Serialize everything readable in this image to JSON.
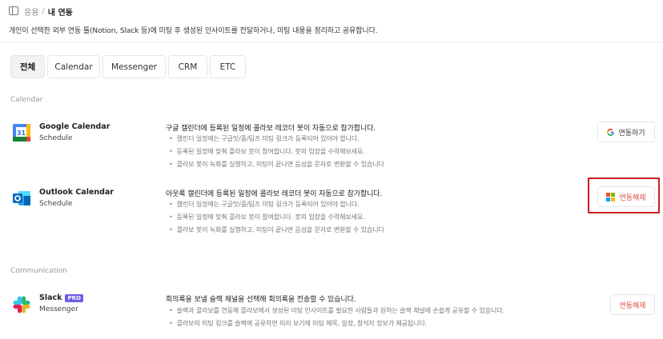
{
  "breadcrumb": {
    "parent": "응용",
    "separator": "/",
    "current": "내 연동"
  },
  "description": "개인이 선택한 외부 연동 툴(Notion, Slack 등)에 미팅 후 생성된 인사이트를 전달하거나, 미팅 내용을 정리하고 공유합니다.",
  "tabs": [
    {
      "label": "전체",
      "active": true
    },
    {
      "label": "Calendar"
    },
    {
      "label": "Messenger"
    },
    {
      "label": "CRM"
    },
    {
      "label": "ETC"
    }
  ],
  "sections": {
    "calendar": "Calendar",
    "communication": "Communication"
  },
  "integrations": {
    "google": {
      "name": "Google Calendar",
      "category": "Schedule",
      "headline": "구글 캘린더에 등록된 일정에 콜라보 레코더 봇이 자동으로 참가합니다.",
      "bullets": [
        "캘린더 일정에는 구글밋/줌/팀즈 미팅 링크가 등록되어 있어야 합니다.",
        "등록된 일정에 맞춰 콜라보 봇이 참여합니다. 봇의 입장을 수락해보세요.",
        "콜라보 봇이 녹화를 실행하고, 미팅이 끝나면 음성을 문자로 변환할 수 있습니다"
      ],
      "button": "연동하기"
    },
    "outlook": {
      "name": "Outlook Calendar",
      "category": "Schedule",
      "headline": "아웃룩 캘린더에 등록된 일정에 콜라보 레코더 봇이 자동으로 참가합니다.",
      "bullets": [
        "캘린더 일정에는 구글밋/줌/팀즈 미팅 링크가 등록되어 있어야 합니다.",
        "등록된 일정에 맞춰 콜라보 봇이 참여합니다. 봇의 입장을 수락해보세요.",
        "콜라보 봇이 녹화를 실행하고, 미팅이 끝나면 음성을 문자로 변환할 수 있습니다"
      ],
      "button": "연동해제"
    },
    "slack": {
      "name": "Slack",
      "badge": "PRO",
      "category": "Messenger",
      "headline": "회의록을 보낼 슬랙 채널을 선택해 회의록을 전송할 수 있습니다.",
      "bullets": [
        "슬랙과 콜라보를 연동해 콜라보에서 생성된 미팅 인사이트를 필요한 사람들과 원하는 슬랙 채널에 손쉽게 공유할 수 있습니다.",
        "콜라보의 미팅 링크를 슬랙에 공유하면 미리 보기에 미팅 제목, 일정, 참석자 정보가 제공됩니다."
      ],
      "button": "연동해제"
    }
  },
  "colors": {
    "disconnect": "#e0493e",
    "highlight": "#cc1f1f",
    "pro_badge": "#6b5ce7"
  }
}
